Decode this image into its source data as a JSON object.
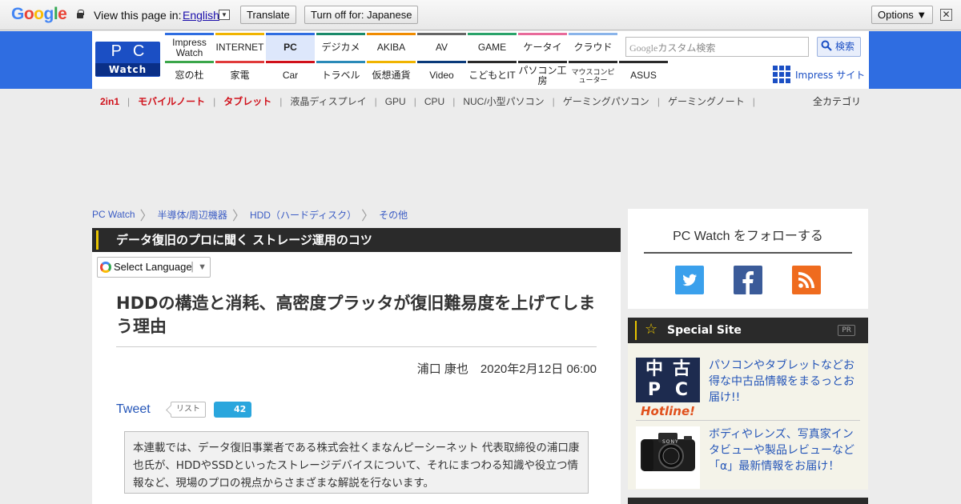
{
  "translate_bar": {
    "logo_letters": [
      "G",
      "o",
      "o",
      "g",
      "l",
      "e"
    ],
    "view_text": "View this page in:",
    "language": "English",
    "dropdown_glyph": "▼",
    "translate_button": "Translate",
    "turn_off_button": "Turn off for: Japanese",
    "options_button": "Options ▼",
    "close_glyph": "✕"
  },
  "header": {
    "logo_pc": "PC",
    "logo_watch": "Watch",
    "nav_top": [
      "Impress Watch",
      "INTERNET",
      "PC",
      "デジカメ",
      "AKIBA",
      "AV",
      "GAME",
      "ケータイ",
      "クラウド"
    ],
    "nav_top_colors": [
      "#2f6de1",
      "#f0b400",
      "#2f6de1",
      "#1a8a6a",
      "#f08c00",
      "#666666",
      "#2aa36a",
      "#e86a9a",
      "#8ab4ea"
    ],
    "nav_bottom": [
      "窓の杜",
      "家電",
      "Car",
      "トラベル",
      "仮想通貨",
      "Video",
      "こどもとIT",
      "パソコン工房",
      "マウスコンピューター",
      "ASUS"
    ],
    "nav_bottom_colors": [
      "#3aa64a",
      "#e03a3a",
      "#d0101a",
      "#2a8ab8",
      "#f0b400",
      "#0a3a7a",
      "#2a2a2a",
      "#2a2a2a",
      "#2a2a2a",
      "#2a2a2a"
    ],
    "search_google": "Google",
    "search_placeholder": "カスタム検索",
    "search_button": "検索",
    "impress_site": "Impress サイト"
  },
  "subnav": {
    "items": [
      "2in1",
      "モバイルノート",
      "タブレット",
      "液晶ディスプレイ",
      "GPU",
      "CPU",
      "NUC/小型パソコン",
      "ゲーミングパソコン",
      "ゲーミングノート"
    ],
    "red_count": 3,
    "separator": "|",
    "all_categories": "全カテゴリ"
  },
  "breadcrumb": [
    "PC Watch",
    "半導体/周辺機器",
    "HDD（ハードディスク）",
    "その他"
  ],
  "article": {
    "series": "データ復旧のプロに聞く ストレージ運用のコツ",
    "select_language": "Select Language",
    "title": "HDDの構造と消耗、高密度プラッタが復旧難易度を上げてしまう理由",
    "author": "浦口 康也",
    "date": "2020年2月12日 06:00",
    "tweet": "Tweet",
    "list_label": "リスト",
    "hatena_count": "42",
    "intro": "本連載では、データ復旧事業者である株式会社くまなんピーシーネット 代表取締役の浦口康也氏が、HDDやSSDといったストレージデバイスについて、それにまつわる知識や役立つ情報など、現場のプロの視点からさまざまな解説を行ないます。"
  },
  "sidebar": {
    "follow_title": "PC Watch をフォローする",
    "social": [
      {
        "icon": "twitter-icon",
        "color": "#3aa0ec"
      },
      {
        "icon": "facebook-icon",
        "color": "#3b5b99"
      },
      {
        "icon": "rss-icon",
        "color": "#ef6b1e"
      }
    ],
    "special_title": "Special Site",
    "pr_label": "PR",
    "items": [
      {
        "thumb_lines": [
          "中",
          "古",
          "P",
          "C"
        ],
        "thumb_tag": "Hotline!",
        "text": "パソコンやタブレットなどお得な中古品情報をまるっとお届け!!"
      },
      {
        "thumb_brand": "SONY",
        "text": "ボディやレンズ、写真家インタビューや製品レビューなど「α」最新情報をお届け！"
      }
    ]
  }
}
